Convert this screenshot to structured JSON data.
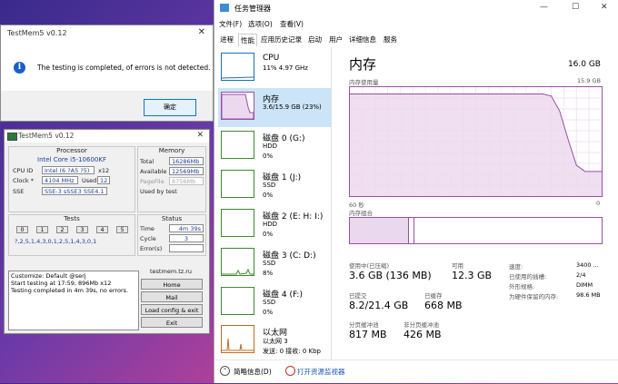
{
  "dialog": {
    "title": "TestMem5 v0.12",
    "close": "✕",
    "info_glyph": "i",
    "message": "The testing is completed, of errors is not detected.",
    "ok_label": "确定"
  },
  "testmem": {
    "title": "TestMem5 v0.12",
    "close": "✕",
    "processor": {
      "header": "Processor",
      "name": "Intel Core i5-10600KF",
      "cpu_id_label": "CPU ID",
      "cpu_id": "Intel (6 ?A5 ?5)",
      "cpu_threads": "x12",
      "clock_label": "Clock *",
      "clock": "4104 MHz",
      "used_label": "Used",
      "used": "12",
      "sse_label": "SSE",
      "sse": "SSE-3 sSSE3 SSE4.1"
    },
    "memory": {
      "header": "Memory",
      "total_label": "Total",
      "total": "16286Mb",
      "available_label": "Available",
      "available": "12569Mb",
      "pagefile_label": "PageFile",
      "pagefile": "8756Mb",
      "usedby_label": "Used by test",
      "usedby": ""
    },
    "tests": {
      "header": "Tests",
      "cells": [
        "0",
        "1",
        "2",
        "3",
        "4",
        "5"
      ],
      "sequence": "?,2,5,1,4,3,0,1,2,5,1,4,3,0,1"
    },
    "status": {
      "header": "Status",
      "time_label": "Time",
      "time": "4m 39s",
      "cycle_label": "Cycle",
      "cycle": "3",
      "errors_label": "Error(s)",
      "errors": ""
    },
    "log": {
      "line1": "Customize: Default @serj",
      "line2": "Start testing at 17:59, 896Mb x12",
      "line3": "Testing completed in 4m 39s, no errors."
    },
    "site": "testmem.tz.ru",
    "buttons": {
      "home": "Home",
      "mail": "Mail",
      "load": "Load config & exit",
      "exit": "Exit"
    }
  },
  "taskmgr": {
    "title": "任务管理器",
    "minimize": "—",
    "maximize": "☐",
    "close": "✕",
    "menu": [
      "文件(F)",
      "选项(O)",
      "查看(V)"
    ],
    "tabs": [
      "进程",
      "性能",
      "应用历史记录",
      "启动",
      "用户",
      "详细信息",
      "服务"
    ],
    "sidebar": [
      {
        "name": "CPU",
        "l1": "11% 4.97 GHz",
        "l2": ""
      },
      {
        "name": "内存",
        "l1": "3.6/15.9 GB (23%)",
        "l2": ""
      },
      {
        "name": "磁盘 0 (G:)",
        "l1": "HDD",
        "l2": "0%"
      },
      {
        "name": "磁盘 1 (J:)",
        "l1": "SSD",
        "l2": "0%"
      },
      {
        "name": "磁盘 2 (E: H: I:)",
        "l1": "HDD",
        "l2": "0%"
      },
      {
        "name": "磁盘 3 (C: D:)",
        "l1": "SSD",
        "l2": "8%"
      },
      {
        "name": "磁盘 4 (F:)",
        "l1": "SSD",
        "l2": "0%"
      },
      {
        "name": "以太网",
        "l1": "以太网 3",
        "l2": "发送: 0 接收: 0 Kbp"
      }
    ],
    "memory": {
      "title": "内存",
      "capacity": "16.0 GB",
      "usage_label": "内存使用量",
      "usage_max": "15.9 GB",
      "axis_left": "60 秒",
      "axis_right": "0",
      "composition_label": "内存组合",
      "stats": {
        "in_use_label": "使用中(已压缩)",
        "in_use": "3.6 GB (136 MB)",
        "available_label": "可用",
        "available": "12.3 GB",
        "committed_label": "已提交",
        "committed": "8.2/21.4 GB",
        "cached_label": "已缓存",
        "cached": "668 MB",
        "paged_label": "分页缓冲池",
        "paged": "817 MB",
        "nonpaged_label": "非分页缓冲池",
        "nonpaged": "426 MB"
      },
      "right": {
        "speed_label": "速度:",
        "speed": "3400 ...",
        "slots_label": "已使用的插槽:",
        "slots": "2/4",
        "form_label": "外形规格:",
        "form": "DIMM",
        "reserved_label": "为硬件保留的内存:",
        "reserved": "98.6 MB"
      },
      "chart_data": {
        "type": "area",
        "title": "内存使用量",
        "ylim": [
          0,
          15.9
        ],
        "x": [
          60,
          58,
          56,
          54,
          52,
          50,
          48,
          46,
          44,
          42,
          40,
          38,
          36,
          34,
          32,
          30,
          28,
          26,
          24,
          22,
          20,
          18,
          16,
          14,
          12,
          10,
          8,
          6,
          4,
          2,
          0
        ],
        "values": [
          14.9,
          14.9,
          14.9,
          14.9,
          14.9,
          14.9,
          14.9,
          14.9,
          14.9,
          14.9,
          14.9,
          14.9,
          14.9,
          14.9,
          14.9,
          14.9,
          14.9,
          14.9,
          14.9,
          14.9,
          14.9,
          14.9,
          14.9,
          14.9,
          14.6,
          12.4,
          8.3,
          4.5,
          3.6,
          3.6,
          3.6
        ]
      },
      "composition": {
        "in_use_fraction": 0.23,
        "modified_fraction": 0.02
      }
    },
    "footer": {
      "brief": "简略信息(D)",
      "monitor": "打开资源监视器"
    },
    "colors": {
      "memory": "#9b4da3",
      "cpu": "#1e6fb8",
      "disk": "#3c8a2e",
      "network": "#c36a1e"
    }
  }
}
